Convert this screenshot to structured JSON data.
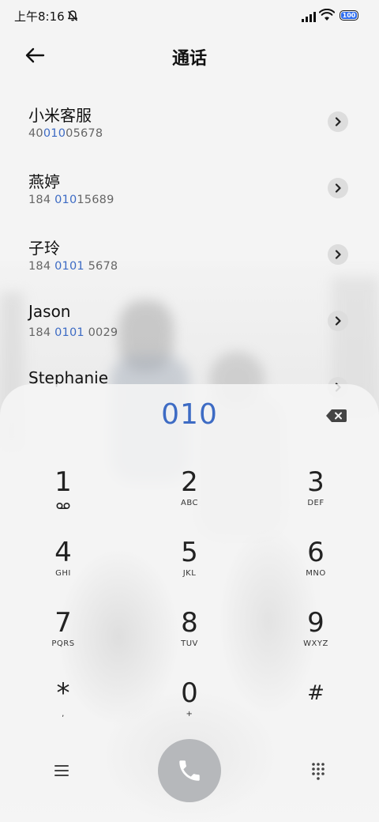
{
  "status_bar": {
    "time": "上午8:16",
    "battery": "100",
    "battery_color": "#2c6cf0"
  },
  "header": {
    "title": "通话",
    "back_icon": "arrow-left-icon"
  },
  "contacts": [
    {
      "name": "小米客服",
      "number_prefix": "40",
      "number_match": "010",
      "number_suffix": "05678"
    },
    {
      "name": "燕婷",
      "number_prefix": "184 ",
      "number_match": "010",
      "number_suffix": "15689"
    },
    {
      "name": "子玲",
      "number_prefix": "184 ",
      "number_match": "0101",
      "number_suffix": " 5678"
    },
    {
      "name": "Jason",
      "number_prefix": "184 ",
      "number_match": "0101",
      "number_suffix": " 0029"
    },
    {
      "name": "Stephanie",
      "number_prefix": "",
      "number_match": "",
      "number_suffix": ""
    }
  ],
  "dialer": {
    "display": "010",
    "highlight_color": "#3d6bc4",
    "keys": [
      {
        "digit": "1",
        "sub": "",
        "sub_icon": "voicemail-icon"
      },
      {
        "digit": "2",
        "sub": "ABC"
      },
      {
        "digit": "3",
        "sub": "DEF"
      },
      {
        "digit": "4",
        "sub": "GHI"
      },
      {
        "digit": "5",
        "sub": "JKL"
      },
      {
        "digit": "6",
        "sub": "MNO"
      },
      {
        "digit": "7",
        "sub": "PQRS"
      },
      {
        "digit": "8",
        "sub": "TUV"
      },
      {
        "digit": "9",
        "sub": "WXYZ"
      },
      {
        "digit": "*",
        "sub": ","
      },
      {
        "digit": "0",
        "sub": "+"
      },
      {
        "digit": "#",
        "sub": ""
      }
    ],
    "icons": {
      "backspace": "backspace-icon",
      "menu": "menu-icon",
      "call": "phone-icon",
      "keypad_toggle": "dialpad-icon"
    }
  }
}
